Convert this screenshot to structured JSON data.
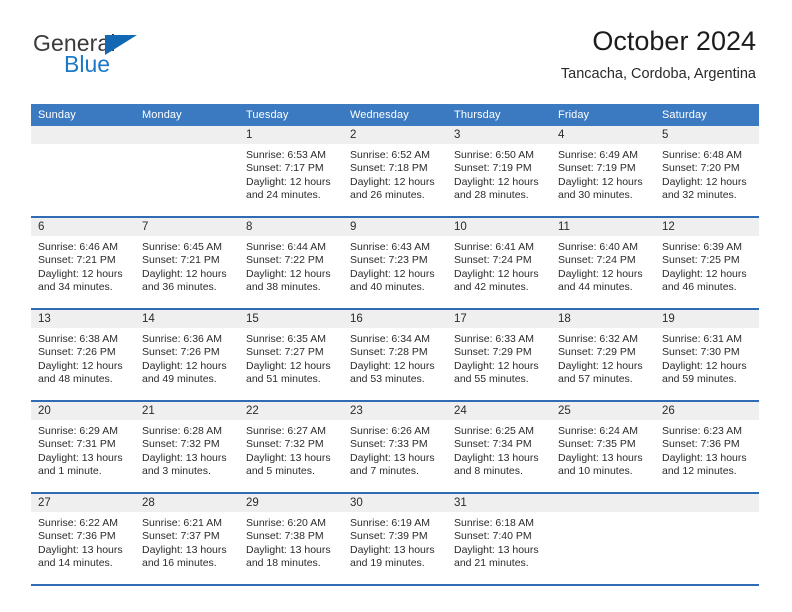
{
  "logo": {
    "word_one": "General",
    "word_two": "Blue",
    "triangle_color": "#1268b3",
    "blue_text_color": "#1b79c8"
  },
  "header": {
    "title": "October 2024",
    "subtitle": "Tancacha, Cordoba, Argentina"
  },
  "theme": {
    "header_blue": "#3b79c0",
    "rule_blue": "#2f6cb5",
    "daynum_band": "#efefef"
  },
  "weekdays": [
    "Sunday",
    "Monday",
    "Tuesday",
    "Wednesday",
    "Thursday",
    "Friday",
    "Saturday"
  ],
  "weeks": [
    [
      {
        "day": "",
        "lines": []
      },
      {
        "day": "",
        "lines": []
      },
      {
        "day": "1",
        "lines": [
          "Sunrise: 6:53 AM",
          "Sunset: 7:17 PM",
          "Daylight: 12 hours",
          "and 24 minutes."
        ]
      },
      {
        "day": "2",
        "lines": [
          "Sunrise: 6:52 AM",
          "Sunset: 7:18 PM",
          "Daylight: 12 hours",
          "and 26 minutes."
        ]
      },
      {
        "day": "3",
        "lines": [
          "Sunrise: 6:50 AM",
          "Sunset: 7:19 PM",
          "Daylight: 12 hours",
          "and 28 minutes."
        ]
      },
      {
        "day": "4",
        "lines": [
          "Sunrise: 6:49 AM",
          "Sunset: 7:19 PM",
          "Daylight: 12 hours",
          "and 30 minutes."
        ]
      },
      {
        "day": "5",
        "lines": [
          "Sunrise: 6:48 AM",
          "Sunset: 7:20 PM",
          "Daylight: 12 hours",
          "and 32 minutes."
        ]
      }
    ],
    [
      {
        "day": "6",
        "lines": [
          "Sunrise: 6:46 AM",
          "Sunset: 7:21 PM",
          "Daylight: 12 hours",
          "and 34 minutes."
        ]
      },
      {
        "day": "7",
        "lines": [
          "Sunrise: 6:45 AM",
          "Sunset: 7:21 PM",
          "Daylight: 12 hours",
          "and 36 minutes."
        ]
      },
      {
        "day": "8",
        "lines": [
          "Sunrise: 6:44 AM",
          "Sunset: 7:22 PM",
          "Daylight: 12 hours",
          "and 38 minutes."
        ]
      },
      {
        "day": "9",
        "lines": [
          "Sunrise: 6:43 AM",
          "Sunset: 7:23 PM",
          "Daylight: 12 hours",
          "and 40 minutes."
        ]
      },
      {
        "day": "10",
        "lines": [
          "Sunrise: 6:41 AM",
          "Sunset: 7:24 PM",
          "Daylight: 12 hours",
          "and 42 minutes."
        ]
      },
      {
        "day": "11",
        "lines": [
          "Sunrise: 6:40 AM",
          "Sunset: 7:24 PM",
          "Daylight: 12 hours",
          "and 44 minutes."
        ]
      },
      {
        "day": "12",
        "lines": [
          "Sunrise: 6:39 AM",
          "Sunset: 7:25 PM",
          "Daylight: 12 hours",
          "and 46 minutes."
        ]
      }
    ],
    [
      {
        "day": "13",
        "lines": [
          "Sunrise: 6:38 AM",
          "Sunset: 7:26 PM",
          "Daylight: 12 hours",
          "and 48 minutes."
        ]
      },
      {
        "day": "14",
        "lines": [
          "Sunrise: 6:36 AM",
          "Sunset: 7:26 PM",
          "Daylight: 12 hours",
          "and 49 minutes."
        ]
      },
      {
        "day": "15",
        "lines": [
          "Sunrise: 6:35 AM",
          "Sunset: 7:27 PM",
          "Daylight: 12 hours",
          "and 51 minutes."
        ]
      },
      {
        "day": "16",
        "lines": [
          "Sunrise: 6:34 AM",
          "Sunset: 7:28 PM",
          "Daylight: 12 hours",
          "and 53 minutes."
        ]
      },
      {
        "day": "17",
        "lines": [
          "Sunrise: 6:33 AM",
          "Sunset: 7:29 PM",
          "Daylight: 12 hours",
          "and 55 minutes."
        ]
      },
      {
        "day": "18",
        "lines": [
          "Sunrise: 6:32 AM",
          "Sunset: 7:29 PM",
          "Daylight: 12 hours",
          "and 57 minutes."
        ]
      },
      {
        "day": "19",
        "lines": [
          "Sunrise: 6:31 AM",
          "Sunset: 7:30 PM",
          "Daylight: 12 hours",
          "and 59 minutes."
        ]
      }
    ],
    [
      {
        "day": "20",
        "lines": [
          "Sunrise: 6:29 AM",
          "Sunset: 7:31 PM",
          "Daylight: 13 hours",
          "and 1 minute."
        ]
      },
      {
        "day": "21",
        "lines": [
          "Sunrise: 6:28 AM",
          "Sunset: 7:32 PM",
          "Daylight: 13 hours",
          "and 3 minutes."
        ]
      },
      {
        "day": "22",
        "lines": [
          "Sunrise: 6:27 AM",
          "Sunset: 7:32 PM",
          "Daylight: 13 hours",
          "and 5 minutes."
        ]
      },
      {
        "day": "23",
        "lines": [
          "Sunrise: 6:26 AM",
          "Sunset: 7:33 PM",
          "Daylight: 13 hours",
          "and 7 minutes."
        ]
      },
      {
        "day": "24",
        "lines": [
          "Sunrise: 6:25 AM",
          "Sunset: 7:34 PM",
          "Daylight: 13 hours",
          "and 8 minutes."
        ]
      },
      {
        "day": "25",
        "lines": [
          "Sunrise: 6:24 AM",
          "Sunset: 7:35 PM",
          "Daylight: 13 hours",
          "and 10 minutes."
        ]
      },
      {
        "day": "26",
        "lines": [
          "Sunrise: 6:23 AM",
          "Sunset: 7:36 PM",
          "Daylight: 13 hours",
          "and 12 minutes."
        ]
      }
    ],
    [
      {
        "day": "27",
        "lines": [
          "Sunrise: 6:22 AM",
          "Sunset: 7:36 PM",
          "Daylight: 13 hours",
          "and 14 minutes."
        ]
      },
      {
        "day": "28",
        "lines": [
          "Sunrise: 6:21 AM",
          "Sunset: 7:37 PM",
          "Daylight: 13 hours",
          "and 16 minutes."
        ]
      },
      {
        "day": "29",
        "lines": [
          "Sunrise: 6:20 AM",
          "Sunset: 7:38 PM",
          "Daylight: 13 hours",
          "and 18 minutes."
        ]
      },
      {
        "day": "30",
        "lines": [
          "Sunrise: 6:19 AM",
          "Sunset: 7:39 PM",
          "Daylight: 13 hours",
          "and 19 minutes."
        ]
      },
      {
        "day": "31",
        "lines": [
          "Sunrise: 6:18 AM",
          "Sunset: 7:40 PM",
          "Daylight: 13 hours",
          "and 21 minutes."
        ]
      },
      {
        "day": "",
        "lines": []
      },
      {
        "day": "",
        "lines": []
      }
    ]
  ]
}
